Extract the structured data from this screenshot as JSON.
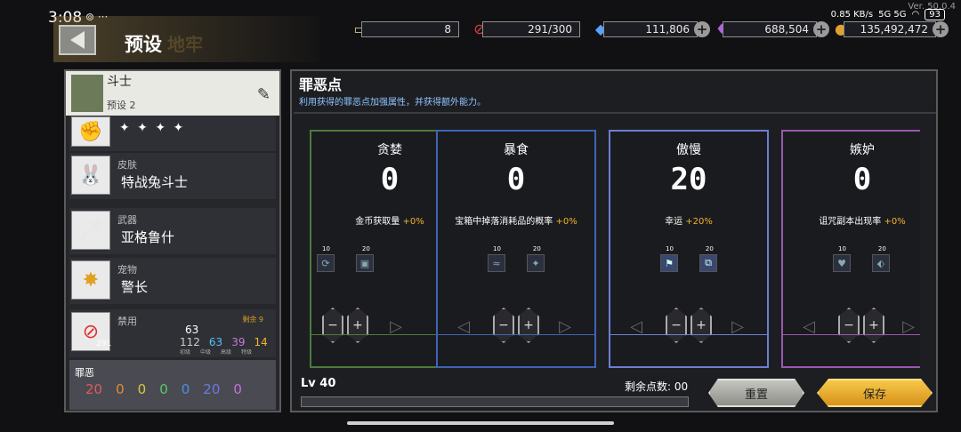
{
  "status": {
    "time": "3:08",
    "icons_text": "⊚ ···",
    "net_speed": "0.85 KB/s",
    "signal": "5G 5G",
    "battery": "93",
    "version": "Ver. 50.0.4"
  },
  "header": {
    "title": "预设",
    "ghost_text": "地牢"
  },
  "currency": [
    {
      "icon": "scroll-icon",
      "value": "8"
    },
    {
      "icon": "ban-icon",
      "value": "291/300"
    },
    {
      "icon": "gem-icon",
      "value": "111,806"
    },
    {
      "icon": "crystal-icon",
      "value": "688,504"
    },
    {
      "icon": "gold-icon",
      "value": "135,492,472"
    }
  ],
  "left": {
    "char_name": "斗士",
    "preset": "预设 2",
    "rank_stars": "✦ ✦ ✦ ✦",
    "slots": [
      {
        "type": "皮肤",
        "name": "特战兔斗士",
        "icon": "bunny-skin-icon"
      },
      {
        "type": "武器",
        "name": "亚格鲁什",
        "icon": "sword-icon"
      },
      {
        "type": "宠物",
        "name": "警长",
        "icon": "sheriff-badge-icon"
      }
    ],
    "ban": {
      "label": "禁用",
      "remaining": "剩余 9",
      "count": "291",
      "top_value": "63",
      "values": [
        "112",
        "63",
        "39",
        "14"
      ],
      "tiers": [
        "初级",
        "中级",
        "高级",
        "特级"
      ]
    },
    "sin": {
      "label": "罪恶",
      "values": [
        "20",
        "0",
        "0",
        "0",
        "0",
        "20",
        "0"
      ]
    }
  },
  "right": {
    "title": "罪恶点",
    "desc": "利用获得的罪恶点加强属性，并获得额外能力。",
    "cards": [
      {
        "title": "贪婪",
        "value": "0",
        "effect": "金币获取量",
        "bonus": "+0%",
        "lvl_a": "10",
        "lvl_b": "20",
        "border": "#4d7a3c"
      },
      {
        "title": "暴食",
        "value": "0",
        "effect": "宝箱中掉落消耗品的概率",
        "bonus": "+0%",
        "lvl_a": "10",
        "lvl_b": "20",
        "border": "#3f64b8"
      },
      {
        "title": "傲慢",
        "value": "20",
        "effect": "幸运",
        "bonus": "+20%",
        "lvl_a": "10",
        "lvl_b": "20",
        "border": "#6e7fd0"
      },
      {
        "title": "嫉妒",
        "value": "0",
        "effect": "诅咒副本出现率",
        "bonus": "+0%",
        "lvl_a": "10",
        "lvl_b": "20",
        "border": "#9a58b0"
      }
    ],
    "lv": "Lv 40",
    "remaining": "剩余点数: 00",
    "reset": "重置",
    "save": "保存"
  }
}
